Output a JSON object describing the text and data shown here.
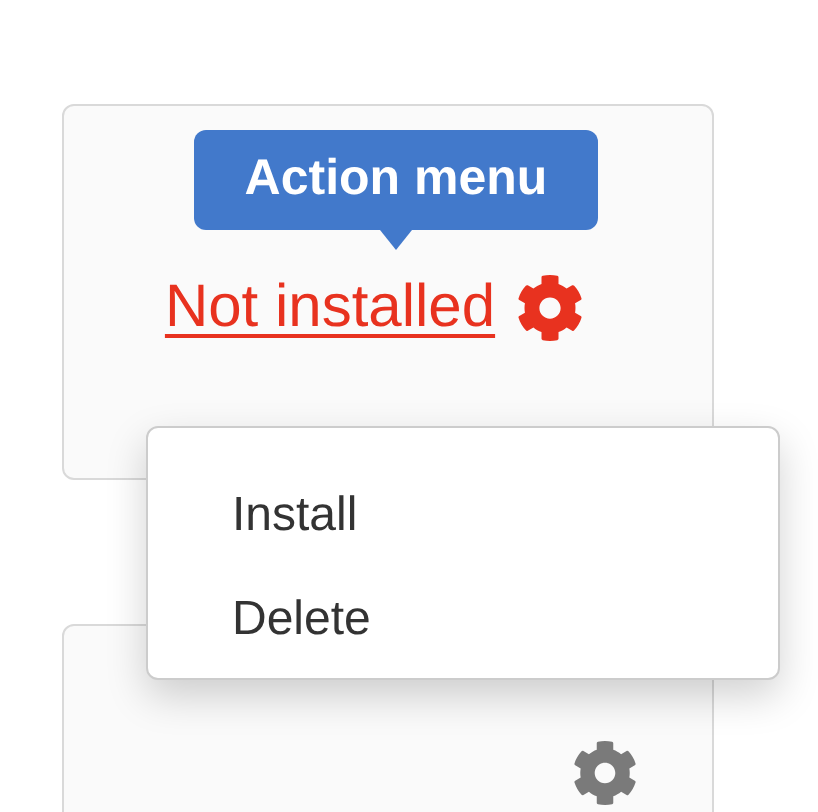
{
  "tooltip": {
    "text": "Action menu"
  },
  "cards": [
    {
      "status": "Not installed",
      "alert": true
    },
    {
      "alert": false
    }
  ],
  "menu": {
    "items": [
      "Install",
      "Delete"
    ]
  }
}
